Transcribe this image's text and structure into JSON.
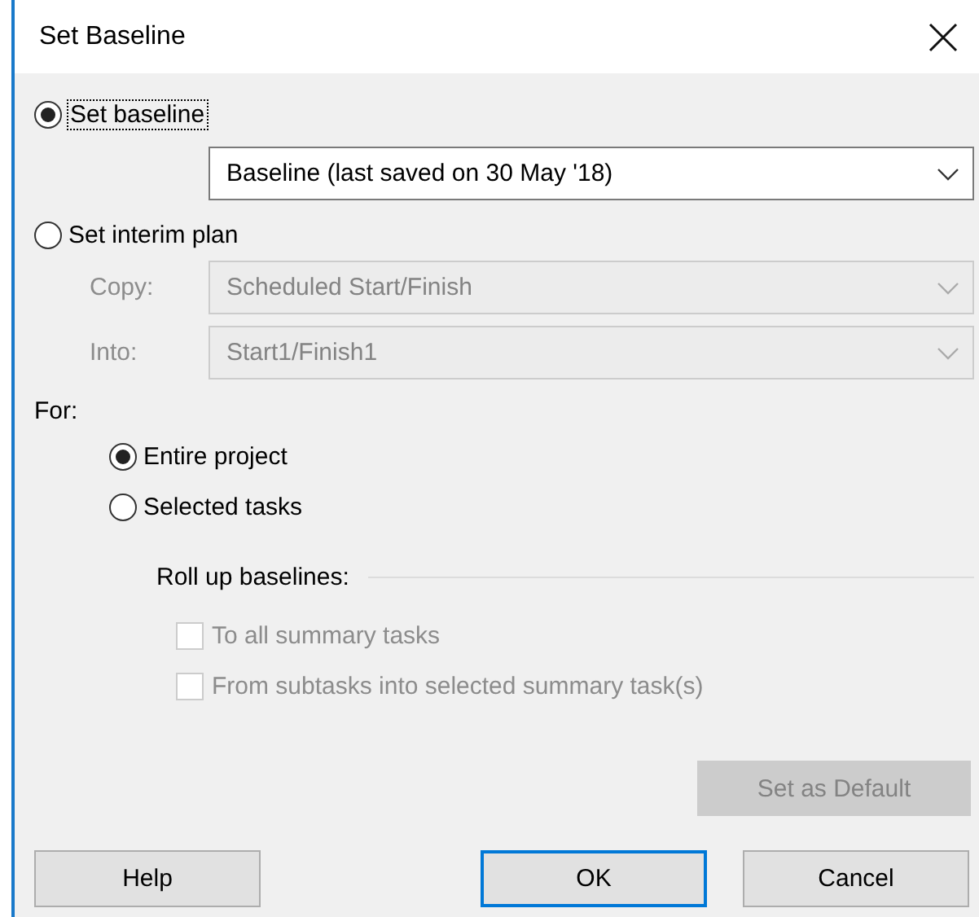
{
  "window": {
    "title": "Set Baseline"
  },
  "plan_choice": [
    {
      "label": "Set baseline",
      "selected": true,
      "focused": true
    },
    {
      "label": "Set interim plan",
      "selected": false,
      "focused": false
    }
  ],
  "baseline_field": {
    "value": "Baseline (last saved on 30 May '18)",
    "disabled": false
  },
  "interim_fields": [
    {
      "label": "Copy:",
      "value": "Scheduled Start/Finish",
      "disabled": true
    },
    {
      "label": "Into:",
      "value": "Start1/Finish1",
      "disabled": true
    }
  ],
  "for": {
    "label": "For:",
    "options": [
      {
        "label": "Entire project",
        "selected": true
      },
      {
        "label": "Selected tasks",
        "selected": false
      }
    ]
  },
  "rollup": {
    "label": "Roll up baselines:",
    "options": [
      {
        "label": "To all summary tasks",
        "checked": false,
        "disabled": true
      },
      {
        "label": "From subtasks into selected summary task(s)",
        "checked": false,
        "disabled": true
      }
    ]
  },
  "default_button": {
    "label": "Set as Default",
    "disabled": true
  },
  "buttons": [
    {
      "label": "Help",
      "default": false
    },
    {
      "label": "OK",
      "default": true
    },
    {
      "label": "Cancel",
      "default": false
    }
  ]
}
